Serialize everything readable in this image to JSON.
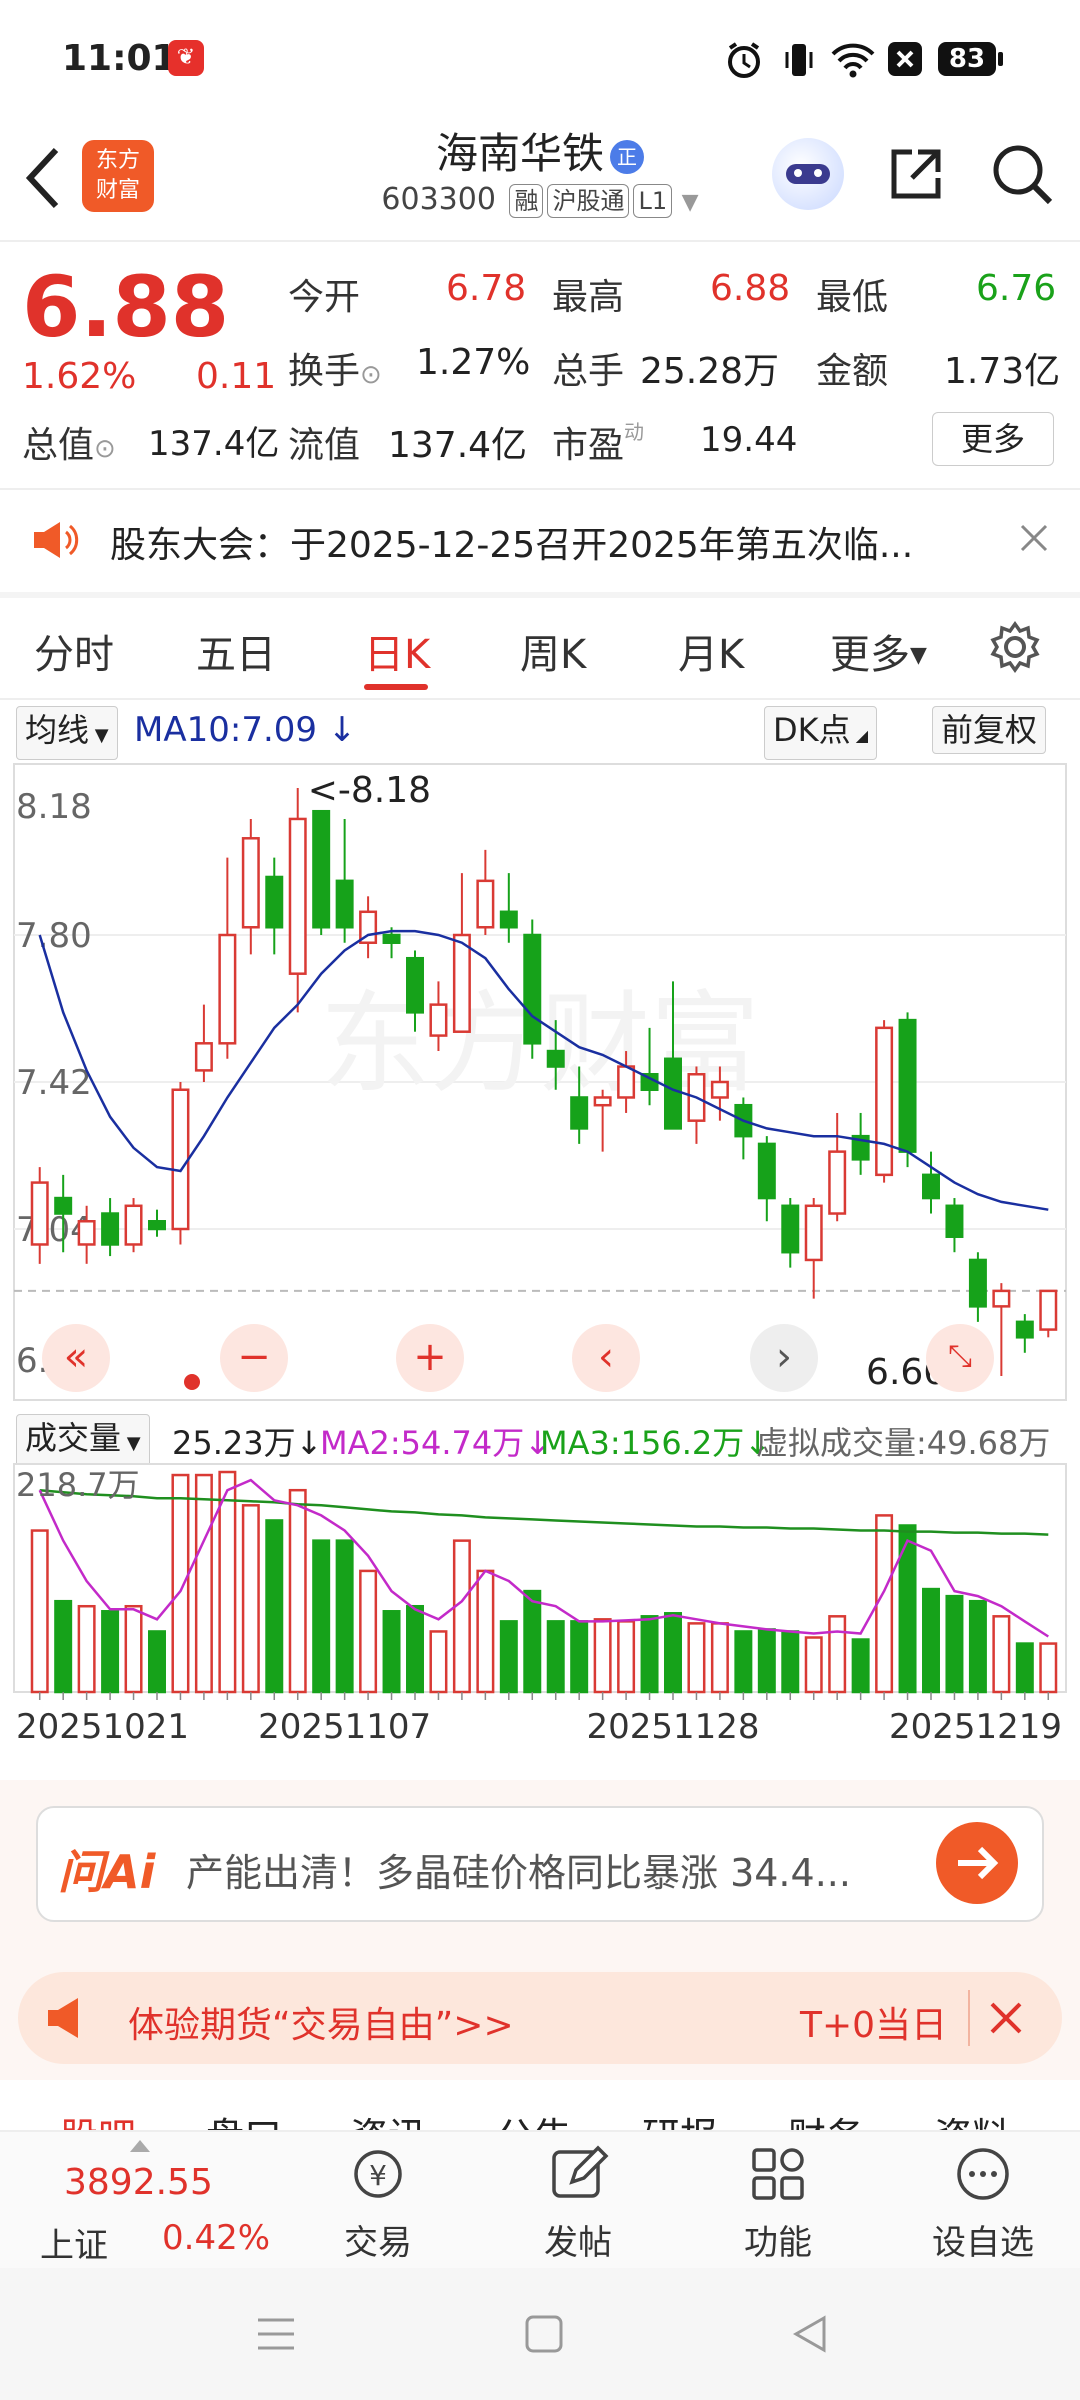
{
  "status_bar": {
    "time": "11:01",
    "battery": "83"
  },
  "header": {
    "stock_name": "海南华铁",
    "stock_code": "603300",
    "tags": [
      "融",
      "沪股通",
      "L1"
    ],
    "logo_text_1": "东方",
    "logo_text_2": "财富",
    "name_badge": "正"
  },
  "quote": {
    "price": "6.88",
    "change_pct": "1.62%",
    "change": "0.11",
    "open_label": "今开",
    "open": "6.78",
    "high_label": "最高",
    "high": "6.88",
    "low_label": "最低",
    "low": "6.76",
    "turnover_label": "换手",
    "turnover": "1.27%",
    "volume_label": "总手",
    "volume": "25.28万",
    "amount_label": "金额",
    "amount": "1.73亿",
    "mktcap_label": "总值",
    "mktcap": "137.4亿",
    "float_label": "流值",
    "float_cap": "137.4亿",
    "pe_label": "市盈",
    "pe_sup": "动",
    "pe": "19.44",
    "more": "更多"
  },
  "notice": {
    "text": "股东大会：于2025-12-25召开2025年第五次临..."
  },
  "tabs": [
    "分时",
    "五日",
    "日K",
    "周K",
    "月K",
    "更多"
  ],
  "active_tab": "日K",
  "chart_controls": {
    "ma_select": "均线",
    "ma10": "MA10:7.09 ↓",
    "dk_point": "DK点",
    "adjust": "前复权"
  },
  "volume_controls": {
    "select": "成交量",
    "vol": "25.23万↓",
    "ma2": "MA2:54.74万↓",
    "ma3": "MA3:156.2万↓",
    "virtual": "虚拟成交量:49.68万",
    "max_label": "218.7万"
  },
  "chart_data": {
    "type": "candlestick",
    "y_ticks": [
      "8.18",
      "7.80",
      "7.42",
      "7.04",
      "6.66"
    ],
    "ylim": [
      6.66,
      8.18
    ],
    "high_annotation": "<-8.18",
    "low_annotation": "6.66->",
    "x_labels": [
      "20251021",
      "20251107",
      "20251128",
      "20251219"
    ],
    "candles": [
      {
        "o": 7.0,
        "c": 7.16,
        "h": 7.2,
        "l": 6.95
      },
      {
        "o": 7.12,
        "c": 7.08,
        "h": 7.18,
        "l": 6.98
      },
      {
        "o": 7.0,
        "c": 7.06,
        "h": 7.1,
        "l": 6.95
      },
      {
        "o": 7.08,
        "c": 7.0,
        "h": 7.12,
        "l": 6.97
      },
      {
        "o": 7.0,
        "c": 7.1,
        "h": 7.12,
        "l": 6.98
      },
      {
        "o": 7.06,
        "c": 7.04,
        "h": 7.09,
        "l": 7.02
      },
      {
        "o": 7.04,
        "c": 7.4,
        "h": 7.42,
        "l": 7.0
      },
      {
        "o": 7.45,
        "c": 7.52,
        "h": 7.62,
        "l": 7.42
      },
      {
        "o": 7.52,
        "c": 7.8,
        "h": 8.0,
        "l": 7.48
      },
      {
        "o": 7.82,
        "c": 8.05,
        "h": 8.1,
        "l": 7.75
      },
      {
        "o": 7.95,
        "c": 7.82,
        "h": 8.0,
        "l": 7.75
      },
      {
        "o": 7.7,
        "c": 8.1,
        "h": 8.18,
        "l": 7.6
      },
      {
        "o": 8.12,
        "c": 7.82,
        "h": 8.12,
        "l": 7.8
      },
      {
        "o": 7.94,
        "c": 7.82,
        "h": 8.1,
        "l": 7.78
      },
      {
        "o": 7.78,
        "c": 7.86,
        "h": 7.9,
        "l": 7.74
      },
      {
        "o": 7.8,
        "c": 7.78,
        "h": 7.82,
        "l": 7.74
      },
      {
        "o": 7.74,
        "c": 7.6,
        "h": 7.76,
        "l": 7.55
      },
      {
        "o": 7.54,
        "c": 7.62,
        "h": 7.68,
        "l": 7.5
      },
      {
        "o": 7.55,
        "c": 7.8,
        "h": 7.96,
        "l": 7.55
      },
      {
        "o": 7.82,
        "c": 7.94,
        "h": 8.02,
        "l": 7.8
      },
      {
        "o": 7.86,
        "c": 7.82,
        "h": 7.96,
        "l": 7.78
      },
      {
        "o": 7.8,
        "c": 7.52,
        "h": 7.84,
        "l": 7.48
      },
      {
        "o": 7.5,
        "c": 7.46,
        "h": 7.58,
        "l": 7.4
      },
      {
        "o": 7.38,
        "c": 7.3,
        "h": 7.46,
        "l": 7.26
      },
      {
        "o": 7.36,
        "c": 7.38,
        "h": 7.4,
        "l": 7.24
      },
      {
        "o": 7.38,
        "c": 7.46,
        "h": 7.5,
        "l": 7.34
      },
      {
        "o": 7.44,
        "c": 7.4,
        "h": 7.56,
        "l": 7.36
      },
      {
        "o": 7.48,
        "c": 7.3,
        "h": 7.68,
        "l": 7.3
      },
      {
        "o": 7.32,
        "c": 7.44,
        "h": 7.46,
        "l": 7.26
      },
      {
        "o": 7.38,
        "c": 7.42,
        "h": 7.46,
        "l": 7.32
      },
      {
        "o": 7.36,
        "c": 7.28,
        "h": 7.38,
        "l": 7.22
      },
      {
        "o": 7.26,
        "c": 7.12,
        "h": 7.28,
        "l": 7.06
      },
      {
        "o": 7.1,
        "c": 6.98,
        "h": 7.12,
        "l": 6.94
      },
      {
        "o": 6.96,
        "c": 7.1,
        "h": 7.12,
        "l": 6.86
      },
      {
        "o": 7.08,
        "c": 7.24,
        "h": 7.34,
        "l": 7.06
      },
      {
        "o": 7.28,
        "c": 7.22,
        "h": 7.34,
        "l": 7.18
      },
      {
        "o": 7.18,
        "c": 7.56,
        "h": 7.58,
        "l": 7.16
      },
      {
        "o": 7.58,
        "c": 7.24,
        "h": 7.6,
        "l": 7.2
      },
      {
        "o": 7.18,
        "c": 7.12,
        "h": 7.24,
        "l": 7.08
      },
      {
        "o": 7.1,
        "c": 7.02,
        "h": 7.12,
        "l": 6.98
      },
      {
        "o": 6.96,
        "c": 6.84,
        "h": 6.98,
        "l": 6.8
      },
      {
        "o": 6.84,
        "c": 6.88,
        "h": 6.9,
        "l": 6.66
      },
      {
        "o": 6.8,
        "c": 6.76,
        "h": 6.82,
        "l": 6.72
      },
      {
        "o": 6.78,
        "c": 6.88,
        "h": 6.88,
        "l": 6.76
      }
    ],
    "ma10": [
      7.8,
      7.6,
      7.45,
      7.33,
      7.25,
      7.2,
      7.19,
      7.28,
      7.38,
      7.47,
      7.56,
      7.62,
      7.7,
      7.76,
      7.8,
      7.81,
      7.81,
      7.8,
      7.78,
      7.74,
      7.66,
      7.59,
      7.55,
      7.51,
      7.49,
      7.46,
      7.43,
      7.4,
      7.38,
      7.35,
      7.32,
      7.3,
      7.29,
      7.28,
      7.28,
      7.27,
      7.26,
      7.24,
      7.2,
      7.16,
      7.13,
      7.11,
      7.1,
      7.09
    ],
    "volumes": [
      160,
      90,
      85,
      80,
      85,
      60,
      215,
      215,
      218,
      185,
      170,
      200,
      150,
      150,
      120,
      80,
      85,
      60,
      150,
      120,
      70,
      100,
      70,
      70,
      72,
      70,
      75,
      78,
      68,
      68,
      60,
      62,
      60,
      54,
      75,
      52,
      175,
      165,
      102,
      95,
      90,
      75,
      48,
      48
    ],
    "vol_ma2": [
      200,
      150,
      110,
      82,
      82,
      72,
      100,
      150,
      200,
      210,
      190,
      185,
      175,
      160,
      135,
      100,
      82,
      72,
      90,
      120,
      110,
      90,
      85,
      70,
      70,
      71,
      72,
      76,
      72,
      68,
      65,
      62,
      60,
      58,
      60,
      58,
      100,
      150,
      140,
      100,
      95,
      85,
      70,
      55
    ],
    "vol_ma3": [
      200,
      198,
      196,
      195,
      194,
      192,
      192,
      191,
      190,
      189,
      188,
      186,
      185,
      183,
      181,
      179,
      178,
      176,
      175,
      173,
      172,
      171,
      170,
      169,
      168,
      167,
      166,
      165,
      164,
      164,
      163,
      163,
      162,
      162,
      161,
      160,
      160,
      159,
      159,
      158,
      158,
      157,
      157,
      156
    ]
  },
  "ai_box": {
    "brand": "问Ai",
    "text": "产能出清！多晶硅价格同比暴涨 34.4..."
  },
  "futures_banner": {
    "text": "体验期货“交易自由”>>",
    "right": "T+0当日"
  },
  "sub_tabs": [
    "股吧",
    "盘口",
    "资讯",
    "公告",
    "研报",
    "财务",
    "资料"
  ],
  "bottom_nav": {
    "index_value": "3892.55",
    "index_name": "上证",
    "index_change": "0.42%",
    "items": [
      "交易",
      "发帖",
      "功能",
      "设自选"
    ]
  }
}
